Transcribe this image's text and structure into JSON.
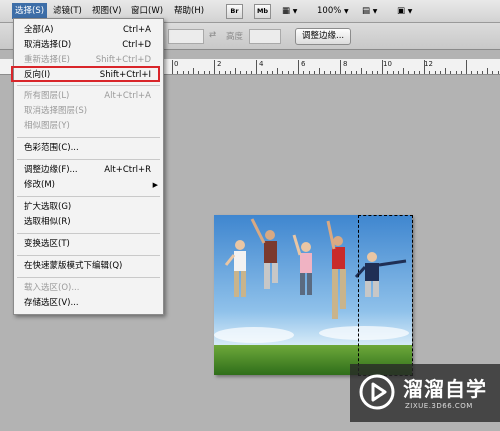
{
  "menubar": {
    "items": [
      "选择(S)",
      "滤镜(T)",
      "视图(V)",
      "窗口(W)",
      "帮助(H)"
    ],
    "active_index": 0,
    "br_label": "Br",
    "mb_label": "Mb",
    "zoom": "100%"
  },
  "options_bar": {
    "height_label": "高度",
    "refine_button": "调整边缘..."
  },
  "ruler": {
    "labels": [
      "0",
      "2",
      "4",
      "6",
      "8",
      "10",
      "12"
    ]
  },
  "dropdown": {
    "items": [
      {
        "label": "全部(A)",
        "shortcut": "Ctrl+A",
        "disabled": false
      },
      {
        "label": "取消选择(D)",
        "shortcut": "Ctrl+D",
        "disabled": false
      },
      {
        "label": "重新选择(E)",
        "shortcut": "Shift+Ctrl+D",
        "disabled": true
      },
      {
        "label": "反向(I)",
        "shortcut": "Shift+Ctrl+I",
        "disabled": false
      },
      {
        "label": "所有图层(L)",
        "shortcut": "Alt+Ctrl+A",
        "disabled": true
      },
      {
        "label": "取消选择图层(S)",
        "shortcut": "",
        "disabled": true
      },
      {
        "label": "相似图层(Y)",
        "shortcut": "",
        "disabled": true
      },
      {
        "label": "色彩范围(C)...",
        "shortcut": "",
        "disabled": false
      },
      {
        "label": "调整边缘(F)...",
        "shortcut": "Alt+Ctrl+R",
        "disabled": false
      },
      {
        "label": "修改(M)",
        "shortcut": "",
        "disabled": false
      },
      {
        "label": "扩大选取(G)",
        "shortcut": "",
        "disabled": false
      },
      {
        "label": "选取相似(R)",
        "shortcut": "",
        "disabled": false
      },
      {
        "label": "变换选区(T)",
        "shortcut": "",
        "disabled": false
      },
      {
        "label": "在快速蒙版模式下编辑(Q)",
        "shortcut": "",
        "disabled": false
      },
      {
        "label": "载入选区(O)...",
        "shortcut": "",
        "disabled": true
      },
      {
        "label": "存储选区(V)...",
        "shortcut": "",
        "disabled": false
      }
    ],
    "highlighted_index": 3
  },
  "watermark": {
    "title": "溜溜自学",
    "subtitle": "ZIXUE.3D66.COM"
  },
  "colors": {
    "menu_active": "#3d6ea8",
    "highlight_border": "#d9252a",
    "workspace": "#b3b3b3"
  }
}
